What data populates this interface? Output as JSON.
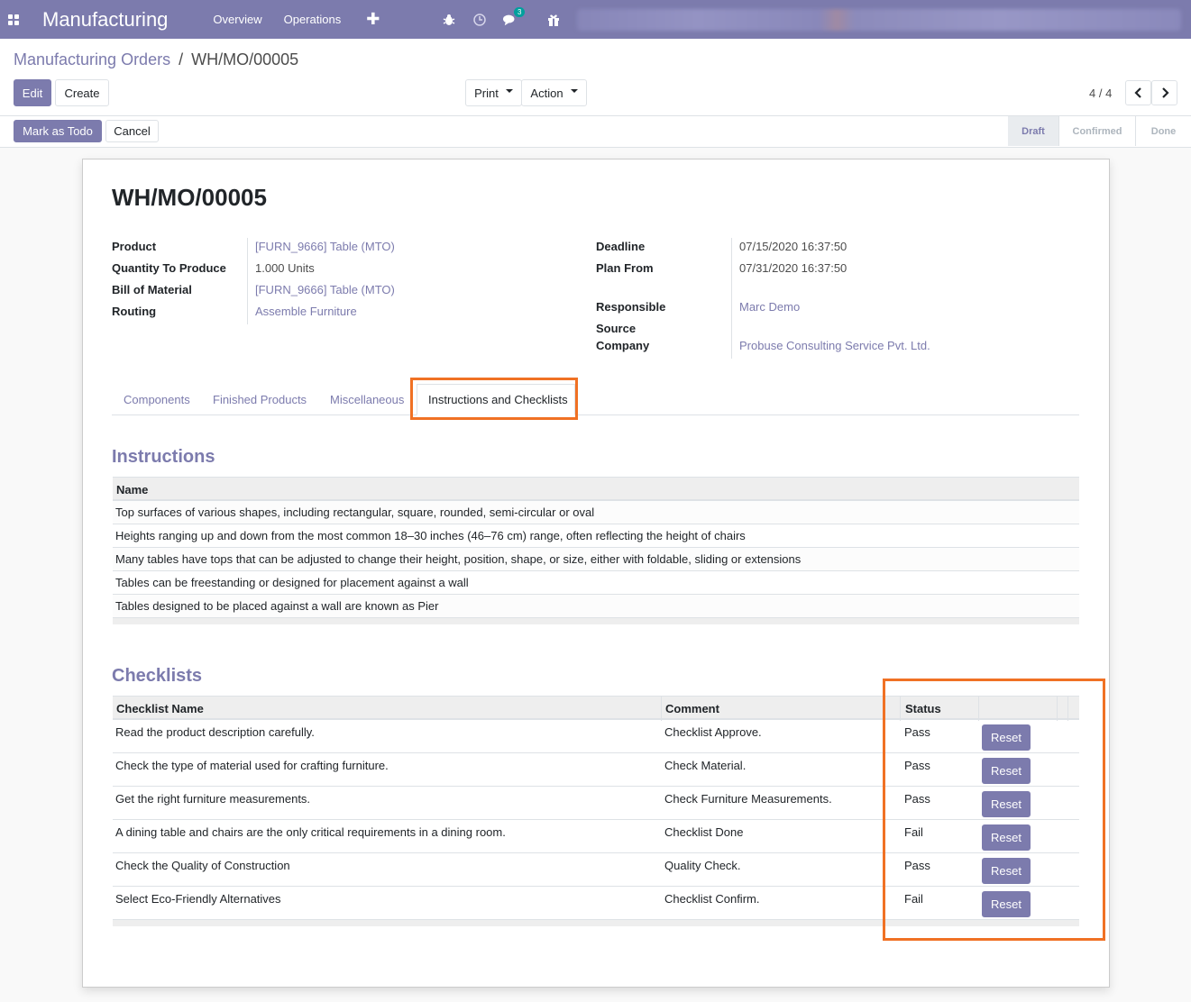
{
  "topnav": {
    "app_name": "Manufacturing",
    "menu": [
      "Overview",
      "Operations"
    ],
    "plus": "✚",
    "chat_badge": "3",
    "bg_color": "#7c7bad"
  },
  "breadcrumb": {
    "parent": "Manufacturing Orders",
    "separator": "/",
    "current": "WH/MO/00005"
  },
  "buttons": {
    "edit": "Edit",
    "create": "Create",
    "print": "Print",
    "action": "Action",
    "mark_todo": "Mark as Todo",
    "cancel": "Cancel"
  },
  "pager": {
    "value": "4 / 4"
  },
  "status_stages": [
    "Draft",
    "Confirmed",
    "Done"
  ],
  "record": {
    "title": "WH/MO/00005",
    "left_fields": [
      {
        "label": "Product",
        "value": "[FURN_9666] Table (MTO)"
      },
      {
        "label": "Quantity To Produce",
        "value": "1.000 Units"
      },
      {
        "label": "Bill of Material",
        "value": "[FURN_9666] Table (MTO)"
      },
      {
        "label": "Routing",
        "value": "Assemble Furniture"
      }
    ],
    "right_fields": [
      {
        "label": "Deadline",
        "value": "07/15/2020 16:37:50"
      },
      {
        "label": "Plan From",
        "value": "07/31/2020 16:37:50"
      },
      {
        "label": "Responsible",
        "value": "Marc Demo"
      },
      {
        "label": "Source",
        "value": ""
      },
      {
        "label": "Company",
        "value": "Probuse Consulting Service Pvt. Ltd."
      }
    ]
  },
  "tabs": [
    "Components",
    "Finished Products",
    "Miscellaneous",
    "Instructions and Checklists"
  ],
  "instructions": {
    "title": "Instructions",
    "header": "Name",
    "rows": [
      "Top surfaces of various shapes, including rectangular, square, rounded, semi-circular or oval",
      "Heights ranging up and down from the most common 18–30 inches (46–76 cm) range, often reflecting the height of chairs",
      "Many tables have tops that can be adjusted to change their height, position, shape, or size, either with foldable, sliding or extensions",
      "Tables can be freestanding or designed for placement against a wall",
      "Tables designed to be placed against a wall are known as Pier"
    ]
  },
  "checklists": {
    "title": "Checklists",
    "headers": [
      "Checklist Name",
      "Comment",
      "Status"
    ],
    "reset_label": "Reset",
    "rows": [
      {
        "name": "Read the product description carefully.",
        "comment": "Checklist Approve.",
        "status": "Pass"
      },
      {
        "name": "Check the type of material used for crafting furniture.",
        "comment": "Check Material.",
        "status": "Pass"
      },
      {
        "name": "Get the right furniture measurements.",
        "comment": "Check Furniture Measurements.",
        "status": "Pass"
      },
      {
        "name": "A dining table and chairs are the only critical requirements in a dining room.",
        "comment": "Checklist Done",
        "status": "Fail"
      },
      {
        "name": "Check the Quality of Construction",
        "comment": "Quality Check.",
        "status": "Pass"
      },
      {
        "name": "Select Eco-Friendly Alternatives",
        "comment": "Checklist Confirm.",
        "status": "Fail"
      }
    ]
  },
  "highlight_color": "#f07124"
}
